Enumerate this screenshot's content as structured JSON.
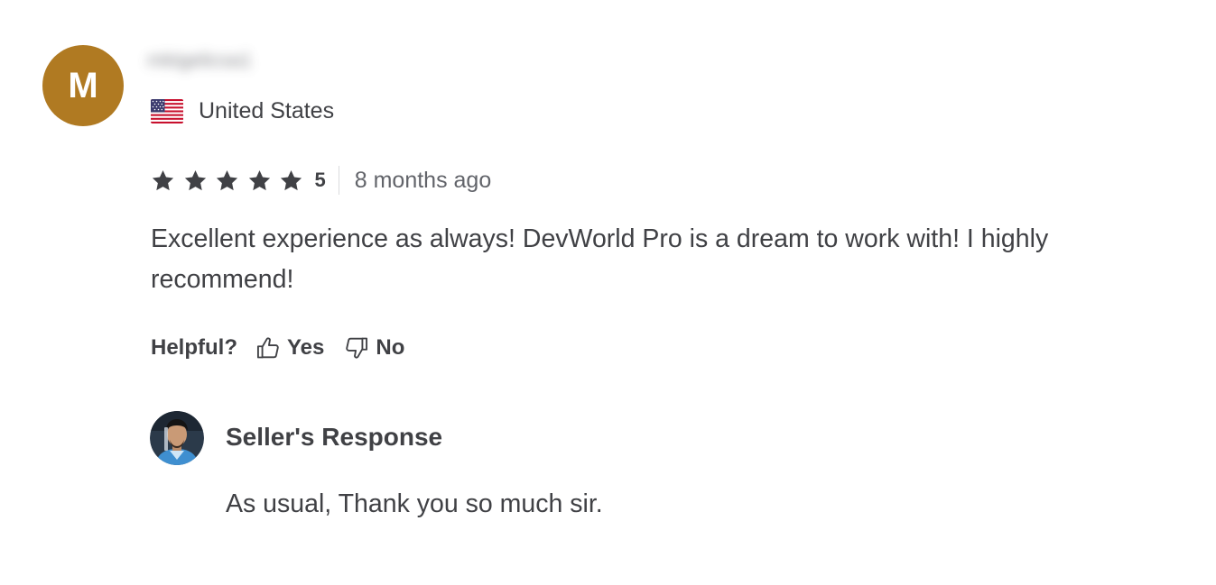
{
  "reviewer": {
    "avatar_letter": "M",
    "avatar_color": "#b07a22",
    "username": "mktgelicsa1",
    "country": "United States",
    "country_flag_icon": "us-flag-icon"
  },
  "rating": {
    "stars": 5,
    "value": "5",
    "star_color": "#404145",
    "time_ago": "8 months ago"
  },
  "review": {
    "text": "Excellent experience as always! DevWorld Pro is a dream to work with! I highly recommend!"
  },
  "helpful": {
    "label": "Helpful?",
    "yes_label": "Yes",
    "no_label": "No",
    "yes_icon": "thumbs-up-icon",
    "no_icon": "thumbs-down-icon"
  },
  "seller_response": {
    "title": "Seller's Response",
    "text": "As usual, Thank you so much sir."
  }
}
